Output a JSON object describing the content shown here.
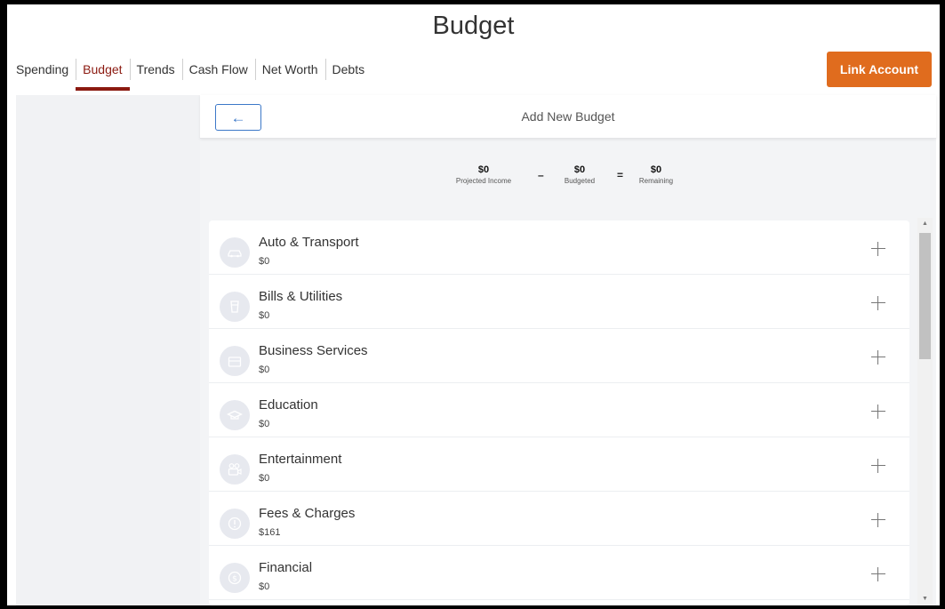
{
  "page": {
    "title": "Budget"
  },
  "tabs": [
    {
      "label": "Spending",
      "active": false
    },
    {
      "label": "Budget",
      "active": true
    },
    {
      "label": "Trends",
      "active": false
    },
    {
      "label": "Cash Flow",
      "active": false
    },
    {
      "label": "Net Worth",
      "active": false
    },
    {
      "label": "Debts",
      "active": false
    }
  ],
  "actions": {
    "link_account_label": "Link Account"
  },
  "panel": {
    "back_icon": "arrow-left-icon",
    "back_arrow": "←",
    "title": "Add New Budget"
  },
  "summary": {
    "projected_income_value": "$0",
    "projected_income_label": "Projected Income",
    "minus": "–",
    "budgeted_value": "$0",
    "budgeted_label": "Budgeted",
    "equals": "=",
    "remaining_value": "$0",
    "remaining_label": "Remaining"
  },
  "categories": [
    {
      "name": "Auto & Transport",
      "amount": "$0",
      "icon": "car-icon"
    },
    {
      "name": "Bills & Utilities",
      "amount": "$0",
      "icon": "cup-icon"
    },
    {
      "name": "Business Services",
      "amount": "$0",
      "icon": "briefcase-icon"
    },
    {
      "name": "Education",
      "amount": "$0",
      "icon": "graduation-cap-icon"
    },
    {
      "name": "Entertainment",
      "amount": "$0",
      "icon": "film-camera-icon"
    },
    {
      "name": "Fees & Charges",
      "amount": "$161",
      "icon": "alert-circle-icon"
    },
    {
      "name": "Financial",
      "amount": "$0",
      "icon": "dollar-coin-icon"
    }
  ],
  "scrollbar": {
    "up_arrow": "▲",
    "down_arrow": "▼"
  },
  "colors": {
    "accent_red": "#8b1a10",
    "link_account_orange": "#e06c1e",
    "back_button_blue": "#3c78c8",
    "icon_circle": "#e7e9ef"
  }
}
